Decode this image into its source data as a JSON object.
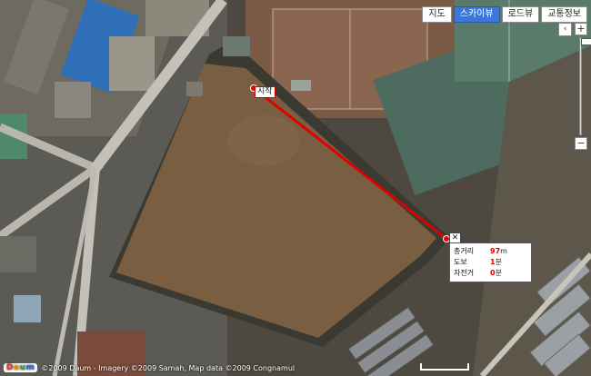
{
  "map_types": [
    "지도",
    "스카이뷰",
    "로드뷰",
    "교통정보"
  ],
  "active_map_type": "스카이뷰",
  "controls": {
    "pan_icon": "‹",
    "zoom_in": "+",
    "zoom_out": "−"
  },
  "route": {
    "start_label": "시작",
    "close_label": "✕",
    "total_distance_label": "총거리",
    "total_distance_value": "97",
    "total_distance_unit": "m",
    "walk_label": "도보",
    "walk_value": "1",
    "walk_unit": "분",
    "bike_label": "자전거",
    "bike_value": "0",
    "bike_unit": "분",
    "line_color": "#e00000"
  },
  "footer": {
    "logo": "Daum",
    "copyright": "©2009 Daum - Imagery ©2009 Samah, Map data ©2009 Congnamul"
  }
}
